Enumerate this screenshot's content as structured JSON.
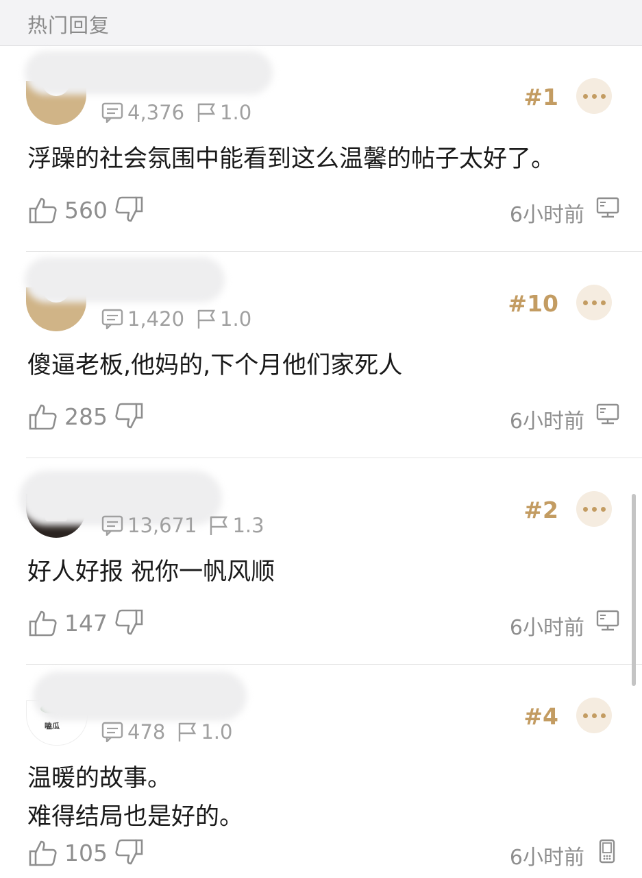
{
  "header": {
    "title": "热门回复"
  },
  "posts": [
    {
      "rank": "#1",
      "replies": "4,376",
      "level": "1.0",
      "content": "浮躁的社会氛围中能看到这么温馨的帖子太好了。",
      "likes": "560",
      "time": "6小时前",
      "device": "desktop-icon"
    },
    {
      "rank": "#10",
      "replies": "1,420",
      "level": "1.0",
      "content": "傻逼老板,他妈的,下个月他们家死人",
      "likes": "285",
      "time": "6小时前",
      "device": "desktop-icon"
    },
    {
      "rank": "#2",
      "replies": "13,671",
      "level": "1.3",
      "content": "好人好报 祝你一帆风顺",
      "likes": "147",
      "time": "6小时前",
      "device": "desktop-icon"
    },
    {
      "rank": "#4",
      "replies": "478",
      "level": "1.0",
      "content_line1": "温暖的故事。",
      "content_line2": "难得结局也是好的。",
      "avatar_text": "嗑瓜",
      "likes": "105",
      "time": "6小时前",
      "device": "phone-icon"
    }
  ],
  "colors": {
    "accent": "#c39c62",
    "accent_bg": "#f5ece0",
    "muted": "#8e8e8e"
  }
}
